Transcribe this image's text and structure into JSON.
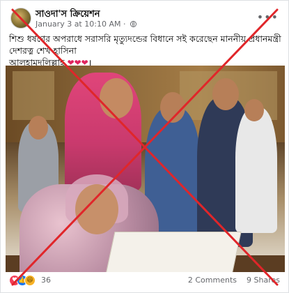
{
  "post": {
    "page_name": "সাওদা'স ক্রিয়েশন",
    "date": "January 3 at 10:10 AM",
    "separator": " · ",
    "text_line1": "শিশু ধর্ষণের অপরাধে সরাসরি মৃত্যুদন্ডের বিধানে সই করেছেন মাননীয় প্রধানমন্ত্রী দেশরত্ন শেখ হাসিনা",
    "text_line2": "আলহামদুলিল্লাহ",
    "hearts": "❤❤❤",
    "end_mark": "।",
    "more_glyph": "•••"
  },
  "reactions": {
    "love_glyph": "♥",
    "like_glyph": "👍",
    "haha_glyph": "😆",
    "count": "36",
    "comments": "2 Comments",
    "shares": "9 Shares"
  },
  "overlay": {
    "color": "#e0262a"
  }
}
